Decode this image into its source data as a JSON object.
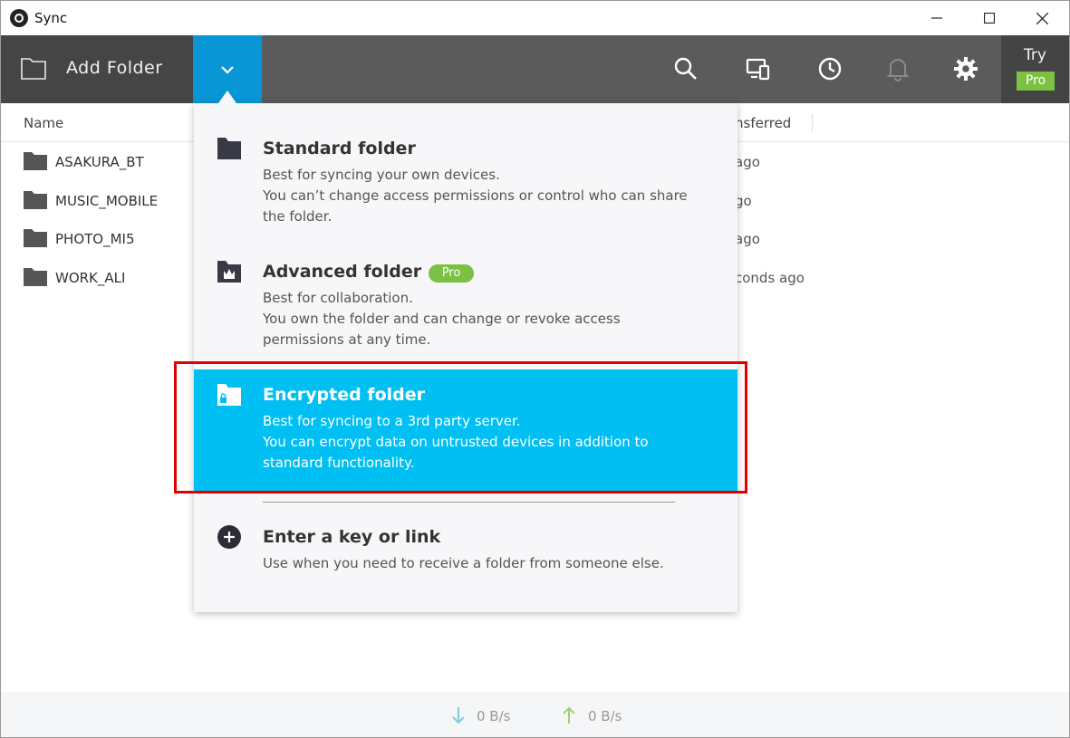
{
  "window": {
    "title": "Sync"
  },
  "toolbar": {
    "add_folder_label": "Add Folder",
    "try_label": "Try",
    "pro_label": "Pro"
  },
  "list": {
    "columns": {
      "name": "Name",
      "transferred": "nsferred"
    },
    "rows": [
      {
        "name": "ASAKURA_BT",
        "time": "ago"
      },
      {
        "name": "MUSIC_MOBILE",
        "time": "go"
      },
      {
        "name": "PHOTO_MI5",
        "time": "ago"
      },
      {
        "name": "WORK_ALI",
        "time": "conds ago"
      }
    ]
  },
  "menu": {
    "standard": {
      "title": "Standard folder",
      "desc1": "Best for syncing your own devices.",
      "desc2": "You can’t change access permissions or control who can share the folder."
    },
    "advanced": {
      "title": "Advanced folder",
      "badge": "Pro",
      "desc1": "Best for collaboration.",
      "desc2": "You own the folder and can change or revoke access permissions at any time."
    },
    "encrypted": {
      "title": "Encrypted folder",
      "desc1": "Best for syncing to a 3rd party server.",
      "desc2": "You can encrypt data on untrusted devices in addition to standard functionality."
    },
    "key": {
      "title": "Enter a key or link",
      "desc1": "Use when you need to receive a folder from someone else."
    }
  },
  "status": {
    "download_rate": "0 B/s",
    "upload_rate": "0 B/s"
  },
  "colors": {
    "accent": "#0896d6",
    "highlight": "#00bff3",
    "pro": "#7cc143",
    "annotation": "#e50000"
  }
}
